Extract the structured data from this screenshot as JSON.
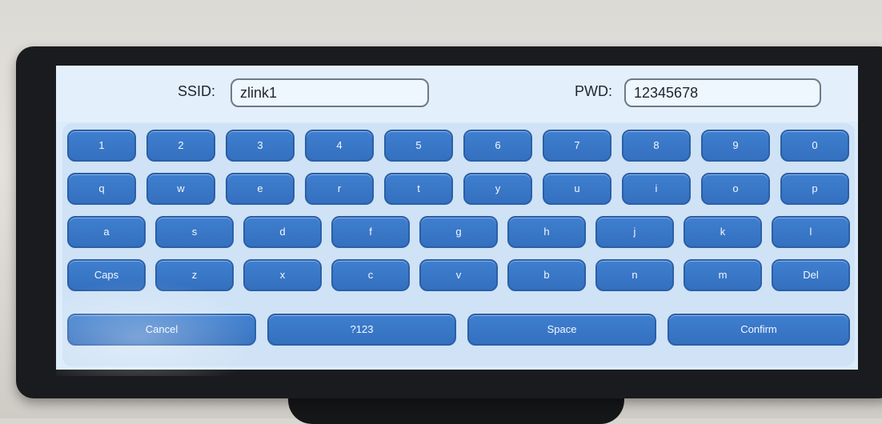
{
  "form": {
    "ssid_label": "SSID:",
    "ssid_value": "zlink1",
    "pwd_label": "PWD:",
    "pwd_value": "12345678"
  },
  "keyboard": {
    "rows": [
      [
        "1",
        "2",
        "3",
        "4",
        "5",
        "6",
        "7",
        "8",
        "9",
        "0"
      ],
      [
        "q",
        "w",
        "e",
        "r",
        "t",
        "y",
        "u",
        "i",
        "o",
        "p"
      ],
      [
        "a",
        "s",
        "d",
        "f",
        "g",
        "h",
        "j",
        "k",
        "l"
      ],
      [
        "Caps",
        "z",
        "x",
        "c",
        "v",
        "b",
        "n",
        "m",
        "Del"
      ],
      [
        "Cancel",
        "?123",
        "Space",
        "Confirm"
      ]
    ]
  },
  "colors": {
    "key_blue": "#3a78c9",
    "screen_bg": "#dcecfb"
  }
}
